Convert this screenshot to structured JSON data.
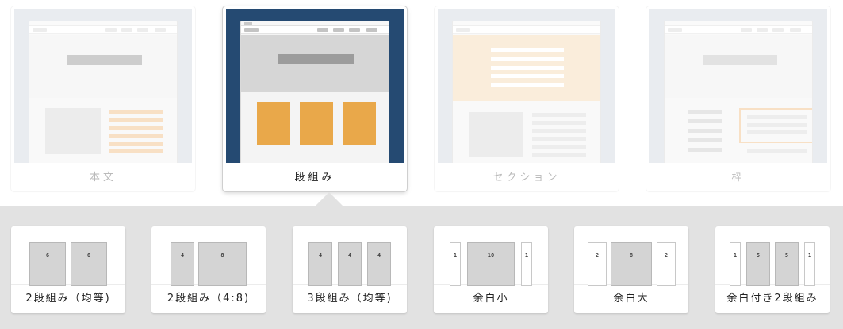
{
  "categories": [
    {
      "label": "本文",
      "state": "inactive"
    },
    {
      "label": "段組み",
      "state": "active"
    },
    {
      "label": "セクション",
      "state": "inactive"
    },
    {
      "label": "枠",
      "state": "inactive"
    }
  ],
  "layouts": [
    {
      "label": "2段組み（均等)",
      "columns": [
        "6",
        "6"
      ]
    },
    {
      "label": "2段組み（4:8)",
      "columns": [
        "4",
        "8"
      ]
    },
    {
      "label": "3段組み（均等)",
      "columns": [
        "4",
        "4",
        "4"
      ]
    },
    {
      "label": "余白小",
      "columns": [
        "1",
        "10",
        "1"
      ]
    },
    {
      "label": "余白大",
      "columns": [
        "2",
        "8",
        "2"
      ]
    },
    {
      "label": "余白付き2段組み",
      "columns": [
        "1",
        "5",
        "5",
        "1"
      ]
    }
  ],
  "colors": {
    "active_bg": "#254a72",
    "column_orange": "#e9a84a",
    "section_orange": "#f9ecdb",
    "panel_gray": "#e2e2e2",
    "thumb_gray": "#d4dbe3"
  }
}
